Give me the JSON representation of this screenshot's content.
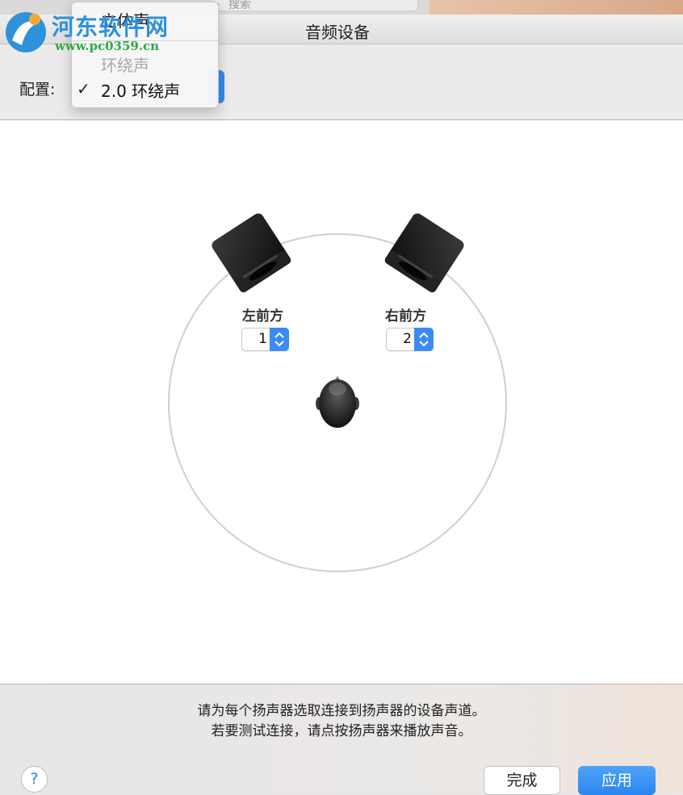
{
  "window": {
    "title": "音频设备"
  },
  "toolbar": {
    "search_placeholder": "搜索"
  },
  "config": {
    "label": "配置:",
    "menu_items": [
      {
        "label": "立体声",
        "checked": false,
        "enabled": true
      },
      {
        "label": "环绕声",
        "checked": false,
        "enabled": false
      },
      {
        "label": "2.0 环绕声",
        "checked": true,
        "enabled": true
      }
    ],
    "checkmark": "✓"
  },
  "speakers": {
    "left": {
      "label": "左前方",
      "channel": "1"
    },
    "right": {
      "label": "右前方",
      "channel": "2"
    }
  },
  "instructions": {
    "line1": "请为每个扬声器选取连接到扬声器的设备声道。",
    "line2": "若要测试连接，请点按扬声器来播放声音。"
  },
  "buttons": {
    "help": "?",
    "done": "完成",
    "apply": "应用"
  },
  "watermark": {
    "site_name": "河东软件网",
    "url": "www.pc0359.cn"
  },
  "colors": {
    "accent": "#2f8ef0",
    "watermark_blue": "#2e92d8",
    "watermark_green": "#2fa844"
  }
}
